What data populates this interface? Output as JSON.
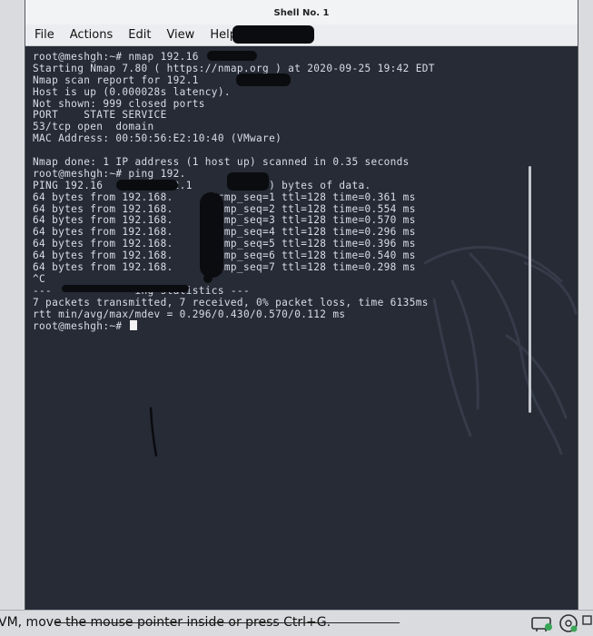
{
  "window": {
    "title": "Shell No. 1"
  },
  "menu": [
    "File",
    "Actions",
    "Edit",
    "View",
    "Help"
  ],
  "terminal": {
    "lines": [
      "root@meshgh:~# nmap 192.16",
      "Starting Nmap 7.80 ( https://nmap.org ) at 2020-09-25 19:42 EDT",
      "Nmap scan report for 192.1",
      "Host is up (0.000028s latency).",
      "Not shown: 999 closed ports",
      "PORT    STATE SERVICE",
      "53/tcp open  domain",
      "MAC Address: 00:50:56:E2:10:40 (VMware)",
      "",
      "Nmap done: 1 IP address (1 host up) scanned in 0.35 seconds",
      "root@meshgh:~# ping 192.",
      "PING 192.16        (192.1       56(84) bytes of data.",
      "64 bytes from 192.168.      icmp_seq=1 ttl=128 time=0.361 ms",
      "64 bytes from 192.168.      icmp_seq=2 ttl=128 time=0.554 ms",
      "64 bytes from 192.168.      icmp_seq=3 ttl=128 time=0.570 ms",
      "64 bytes from 192.168.      icmp_seq=4 ttl=128 time=0.296 ms",
      "64 bytes from 192.168.      icmp_seq=5 ttl=128 time=0.396 ms",
      "64 bytes from 192.168.      icmp_seq=6 ttl=128 time=0.540 ms",
      "64 bytes from 192.168.      icmp_seq=7 ttl=128 time=0.298 ms",
      "^C",
      "---             ing statistics ---",
      "7 packets transmitted, 7 received, 0% packet loss, time 6135ms",
      "rtt min/avg/max/mdev = 0.296/0.430/0.570/0.112 ms"
    ],
    "prompt": "root@meshgh:~# "
  },
  "status_bar": {
    "text": "VM, move the mouse pointer inside or press Ctrl+G."
  },
  "icons": [
    "kali-dragon-icon",
    "network-adapter-icon",
    "cd-drive-icon",
    "usb-icon"
  ],
  "colors": {
    "terminal_bg": "#262b36",
    "terminal_fg": "#d8dde6",
    "menubar_bg": "#ecedf0"
  }
}
